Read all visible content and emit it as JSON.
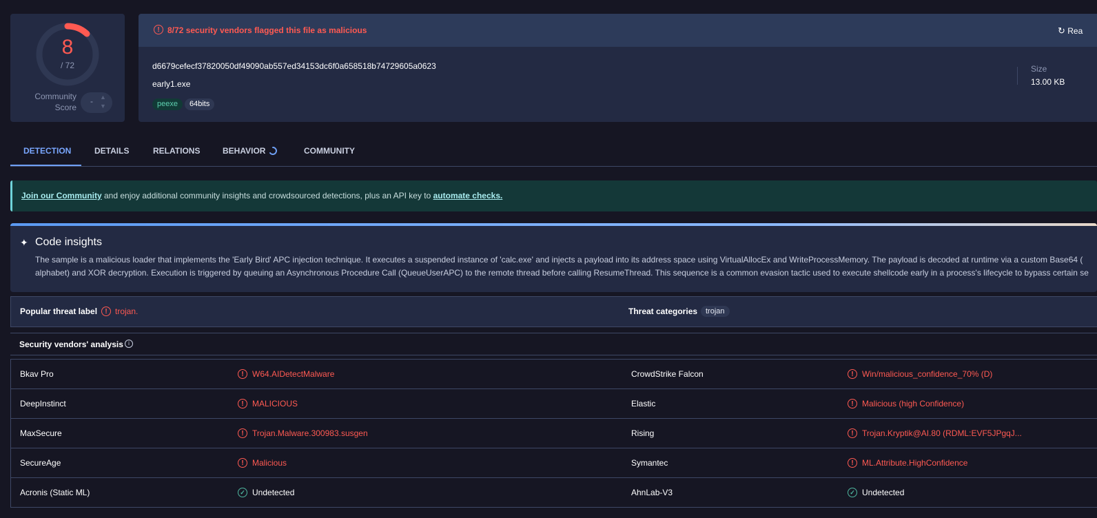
{
  "score": {
    "detected": "8",
    "total": "/ 72",
    "community_label": "Community Score",
    "vote": "-"
  },
  "file": {
    "alert": "8/72 security vendors flagged this file as malicious",
    "reanalyze": "Rea",
    "hash": "d6679cefecf37820050df49090ab557ed34153dc6f0a658518b74729605a0623",
    "name": "early1.exe",
    "tags": [
      "peexe",
      "64bits"
    ],
    "size_label": "Size",
    "size_value": "13.00 KB"
  },
  "tabs": [
    "DETECTION",
    "DETAILS",
    "RELATIONS",
    "BEHAVIOR",
    "COMMUNITY"
  ],
  "banner": {
    "link1": "Join our Community",
    "text": " and enjoy additional community insights and crowdsourced detections, plus an API key to ",
    "link2": "automate checks."
  },
  "code_insights": {
    "title": "Code insights",
    "line1": "The sample is a malicious loader that implements the 'Early Bird' APC injection technique. It executes a suspended instance of 'calc.exe' and injects a payload into its address space using VirtualAllocEx and WriteProcessMemory. The payload is decoded at runtime via a custom Base64 (",
    "line2": "alphabet) and XOR decryption. Execution is triggered by queuing an Asynchronous Procedure Call (QueueUserAPC) to the remote thread before calling ResumeThread. This sequence is a common evasion tactic used to execute shellcode early in a process's lifecycle to bypass certain se"
  },
  "threat": {
    "label": "Popular threat label",
    "value": "trojan.",
    "categories_label": "Threat categories",
    "categories": [
      "trojan"
    ]
  },
  "vendors": {
    "title": "Security vendors' analysis",
    "rows": [
      [
        {
          "vendor": "Bkav Pro",
          "result": "W64.AIDetectMalware",
          "status": "malicious"
        },
        {
          "vendor": "CrowdStrike Falcon",
          "result": "Win/malicious_confidence_70% (D)",
          "status": "malicious"
        }
      ],
      [
        {
          "vendor": "DeepInstinct",
          "result": "MALICIOUS",
          "status": "malicious"
        },
        {
          "vendor": "Elastic",
          "result": "Malicious (high Confidence)",
          "status": "malicious"
        }
      ],
      [
        {
          "vendor": "MaxSecure",
          "result": "Trojan.Malware.300983.susgen",
          "status": "malicious"
        },
        {
          "vendor": "Rising",
          "result": "Trojan.Kryptik@AI.80 (RDML:EVF5JPgqJ...",
          "status": "malicious"
        }
      ],
      [
        {
          "vendor": "SecureAge",
          "result": "Malicious",
          "status": "malicious"
        },
        {
          "vendor": "Symantec",
          "result": "ML.Attribute.HighConfidence",
          "status": "malicious"
        }
      ],
      [
        {
          "vendor": "Acronis (Static ML)",
          "result": "Undetected",
          "status": "undetected"
        },
        {
          "vendor": "AhnLab-V3",
          "result": "Undetected",
          "status": "undetected"
        }
      ]
    ]
  },
  "colors": {
    "malicious": "#ff5a52",
    "undetected": "#4fb8a0",
    "accent": "#7aa7ff"
  }
}
